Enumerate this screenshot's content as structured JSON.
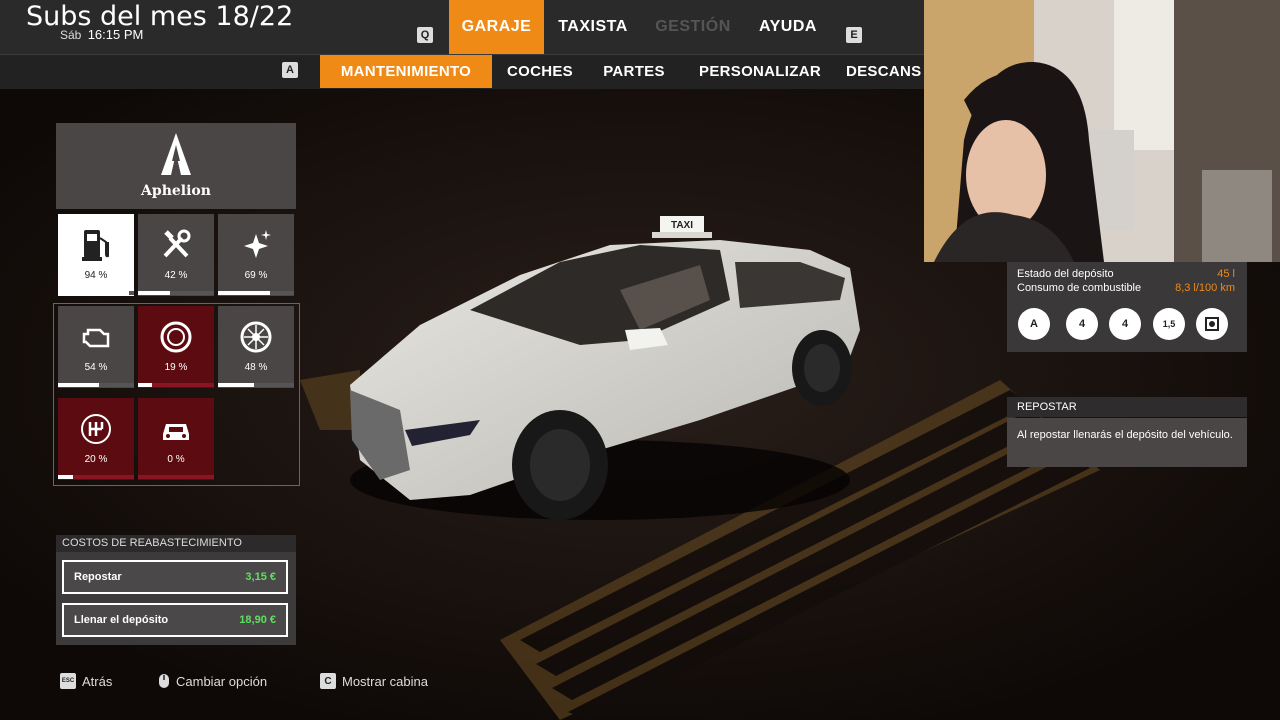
{
  "overlay": {
    "title": "Subs del mes 18/22"
  },
  "clock": {
    "day": "Sáb",
    "time": "16:15 PM"
  },
  "top_tabs": {
    "key_left": "Q",
    "key_right": "E",
    "items": [
      {
        "label": "GARAJE",
        "state": "active"
      },
      {
        "label": "TAXISTA",
        "state": "normal"
      },
      {
        "label": "GESTIÓN",
        "state": "disabled"
      },
      {
        "label": "AYUDA",
        "state": "normal"
      }
    ]
  },
  "sub_tabs": {
    "key_left": "A",
    "items": [
      {
        "label": "MANTENIMIENTO",
        "state": "active"
      },
      {
        "label": "COCHES",
        "state": "normal"
      },
      {
        "label": "PARTES",
        "state": "normal"
      },
      {
        "label": "PERSONALIZAR",
        "state": "normal"
      },
      {
        "label": "DESCANS",
        "state": "normal"
      }
    ]
  },
  "brand": {
    "name": "Aphelion",
    "icon": "aphelion-logo"
  },
  "status_tiles": [
    {
      "icon": "fuel-pump-icon",
      "label": "94 %",
      "level": 0.94,
      "style": "white"
    },
    {
      "icon": "tools-icon",
      "label": "42 %",
      "level": 0.42,
      "style": "gray"
    },
    {
      "icon": "sparkle-icon",
      "label": "69 %",
      "level": 0.69,
      "style": "gray"
    },
    {
      "icon": "engine-icon",
      "label": "54 %",
      "level": 0.54,
      "style": "gray"
    },
    {
      "icon": "brake-disc-icon",
      "label": "19 %",
      "level": 0.19,
      "style": "red"
    },
    {
      "icon": "wheel-icon",
      "label": "48 %",
      "level": 0.48,
      "style": "gray"
    },
    {
      "icon": "gearbox-icon",
      "label": "20 %",
      "level": 0.2,
      "style": "red"
    },
    {
      "icon": "car-body-icon",
      "label": "0 %",
      "level": 0.0,
      "style": "red"
    }
  ],
  "refuel_costs": {
    "heading": "COSTOS DE REABASTECIMIENTO",
    "rows": [
      {
        "label": "Repostar",
        "value": "3,15 €"
      },
      {
        "label": "Llenar el depósito",
        "value": "18,90 €"
      }
    ]
  },
  "hints": [
    {
      "key": "ESC",
      "label": "Atrás"
    },
    {
      "key": "mouse",
      "label": "Cambiar opción"
    },
    {
      "key": "C",
      "label": "Mostrar cabina"
    }
  ],
  "vehicle_info": {
    "rows": [
      {
        "label": "Estado del depósito",
        "value": "45 l"
      },
      {
        "label": "Consumo de combustible",
        "value": "8,3 l/100 km"
      }
    ],
    "features": [
      {
        "icon": "auto-transmission-icon",
        "text": "A"
      },
      {
        "icon": "seats-icon",
        "text": "4"
      },
      {
        "icon": "luggage-icon",
        "text": "4"
      },
      {
        "icon": "weight-icon",
        "text": "1,5"
      },
      {
        "icon": "engine-cylinder-icon",
        "text": ""
      }
    ]
  },
  "action_panel": {
    "title": "REPOSTAR",
    "description": "Al repostar llenarás el depósito del vehículo."
  },
  "car": {
    "roof_sign": "TAXI"
  },
  "colors": {
    "accent": "#f08a16",
    "price": "#5ee05e",
    "critical": "#5c0c10"
  }
}
